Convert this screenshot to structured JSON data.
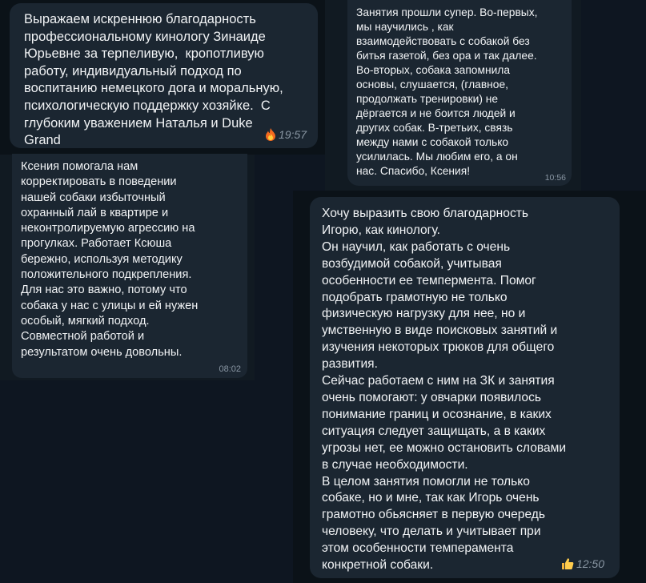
{
  "messages": [
    {
      "text": "Выражаем искреннюю благодарность\nпрофессиональному кинологу Зинаиде\nЮрьевне за терпеливую,  кропотливую\nработу, индивидуальный подход по\nвоспитанию немецкого дога и моральную,\nпсихологическую поддержку хозяйке.  С\nглубоким уважением Наталья и Duke\nGrand",
      "time": "19:57",
      "reaction": "fire-icon"
    },
    {
      "text": "Занятия прошли супер. Во-первых,\nмы научились , как\nвзаимодействовать с собакой без\nбитья газетой, без ора и так далее.\nВо-вторых, собака запомнила\nосновы, слушается, (главное,\nпродолжать тренировки) не\nдёргается и не боится людей и\nдругих собак. В-третьих, связь\nмежду нами с собакой только\nусилилась. Мы любим его, а он\nнас. Спасибо, Ксения!",
      "time": "10:56"
    },
    {
      "text": "Ксения помогала нам\nкорректировать в поведении\nнашей собаки избыточный\nохранный лай в квартире и\nнеконтролируемую агрессию на\nпрогулках. Работает Ксюша\nбережно, используя методику\nположительного подкрепления.\nДля нас это важно, потому что\nсобака у нас с улицы и ей нужен\nособый, мягкий подход.\nСовместной работой и\nрезультатом очень довольны.",
      "time": "08:02"
    },
    {
      "text": "Хочу выразить свою благодарность\nИгорю, как кинологу.\nОн научил, как работать с очень\nвозбудимой собакой, учитывая\nособенности ее темпермента. Помог\nподобрать грамотную не только\nфизическую нагрузку для нее, но и\nумственную в виде поисковых занятий и\nизучения некоторых трюков для общего\nразвития.\nСейчас работаем с ним на ЗК и занятия\nочень помогают: у овчарки появилось\nпонимание границ и осознание, в каких\nситуация следует защищать, а в каких\nугрозы нет, ее можно остановить словами\nв случае необходимости.\nВ целом занятия помогли не только\nсобаке, но и мне, так как Игорь очень\nграмотно обьясняет в первую очередь\nчеловеку, что делать и учитывает при\nэтом особенности темперамента\nконкретной собаки.",
      "time": "12:50",
      "reaction": "thumbs-up-icon"
    }
  ]
}
